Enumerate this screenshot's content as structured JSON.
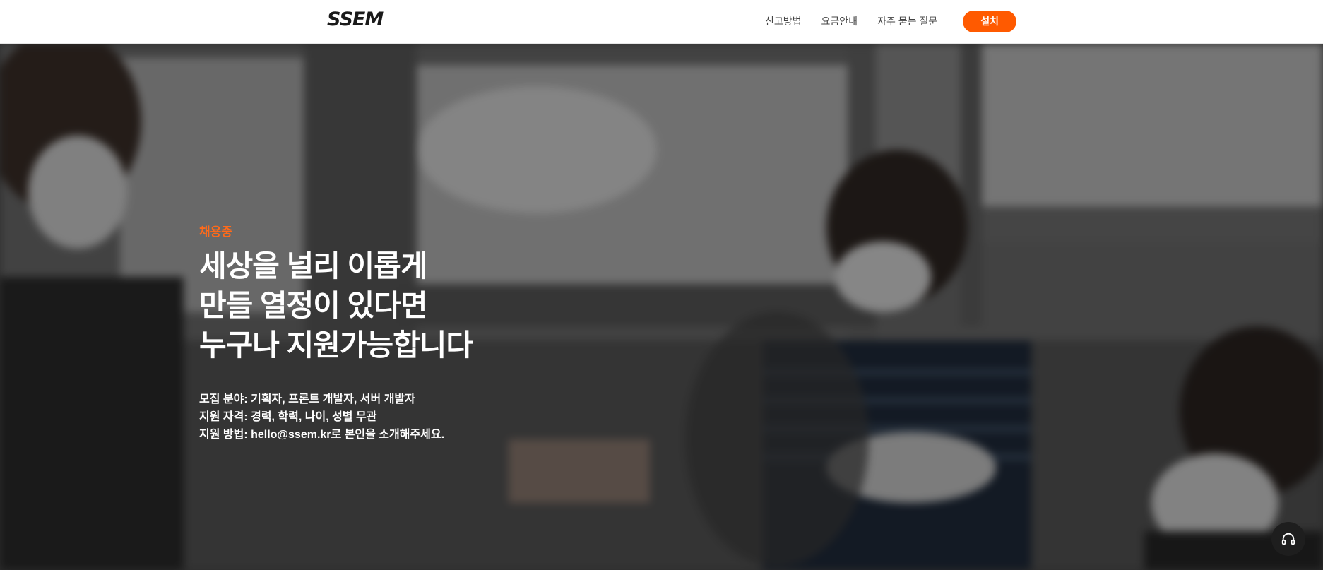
{
  "header": {
    "logo": "SSEM",
    "nav": [
      {
        "label": "신고방법"
      },
      {
        "label": "요금안내"
      },
      {
        "label": "자주 묻는 질문"
      }
    ],
    "install_label": "설치"
  },
  "hero": {
    "badge": "채용중",
    "headline": [
      "세상을 널리 이롭게",
      "만들 열정이 있다면",
      "누구나 지원가능합니다"
    ],
    "details": [
      "모집 분야: 기획자, 프론트 개발자, 서버 개발자",
      "지원 자격: 경력, 학력, 나이, 성별 무관",
      "지원 방법: hello@ssem.kr로 본인을 소개해주세요."
    ]
  },
  "support": {
    "icon": "headset-icon"
  },
  "colors": {
    "accent": "#ff5a00",
    "badge": "#ff6a1a",
    "header_bg": "#ffffff",
    "hero_text": "#ffffff"
  }
}
